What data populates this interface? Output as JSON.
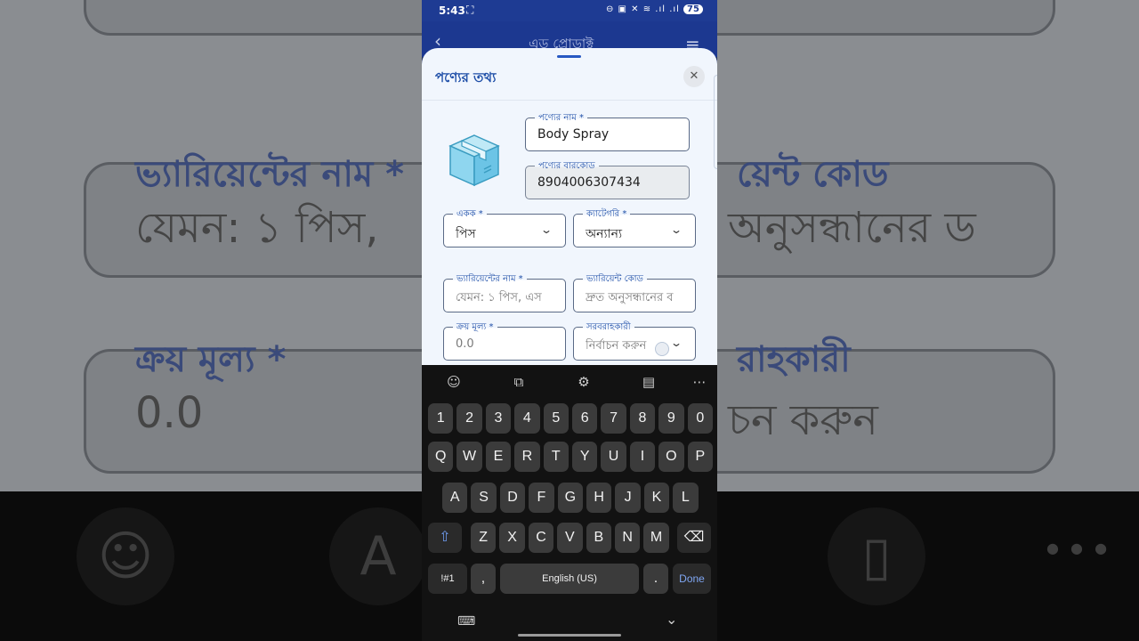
{
  "background": {
    "variant_name_label": "ভ্যারিয়েন্টের নাম *",
    "variant_code_label": "য়েন্ট কোড",
    "variant_name_placeholder": "যেমন: ১ পিস,",
    "variant_code_placeholder": "অনুসন্ধানের ড",
    "purchase_price_label": "ক্রয় মূল্য *",
    "purchase_price_value": "0.0",
    "supplier_label": "রাহকারী",
    "supplier_value": "চন করুন",
    "top_text": "",
    "smiley": "☺",
    "translate": "A",
    "clipboard": "▯",
    "dots": "● ● ●"
  },
  "status_bar": {
    "time": "5:43",
    "battery": "75"
  },
  "app_bar": {
    "title": "এড্ প্রোডাক্ট"
  },
  "sheet": {
    "title": "পণ্যের তথ্য",
    "close": "✕",
    "product_name": {
      "label": "পণ্যের নাম *",
      "value": "Body Spray"
    },
    "barcode": {
      "label": "পণ্যের বারকোড",
      "value": "8904006307434"
    },
    "unit": {
      "label": "একক *",
      "value": "পিস"
    },
    "category": {
      "label": "ক্যাটেগরি *",
      "value": "অন্যান্য"
    },
    "variant_name": {
      "label": "ভ্যারিয়েন্টের নাম *",
      "placeholder": "যেমন: ১ পিস, এস"
    },
    "variant_code": {
      "label": "ভ্যারিয়েন্ট কোড",
      "placeholder": "দ্রুত অনুসন্ধানের ব"
    },
    "purchase_price": {
      "label": "ক্রয় মূল্য *",
      "placeholder": "0.0"
    },
    "supplier": {
      "label": "সরবরাহকারী",
      "placeholder": "নির্বাচন করুন"
    }
  },
  "keyboard": {
    "number_row": [
      "1",
      "2",
      "3",
      "4",
      "5",
      "6",
      "7",
      "8",
      "9",
      "0"
    ],
    "row1": [
      "Q",
      "W",
      "E",
      "R",
      "T",
      "Y",
      "U",
      "I",
      "O",
      "P"
    ],
    "row2": [
      "A",
      "S",
      "D",
      "F",
      "G",
      "H",
      "J",
      "K",
      "L"
    ],
    "row3": [
      "Z",
      "X",
      "C",
      "V",
      "B",
      "N",
      "M"
    ],
    "symbols": "!#1",
    "comma": ",",
    "space": "English (US)",
    "period": ".",
    "done": "Done"
  }
}
